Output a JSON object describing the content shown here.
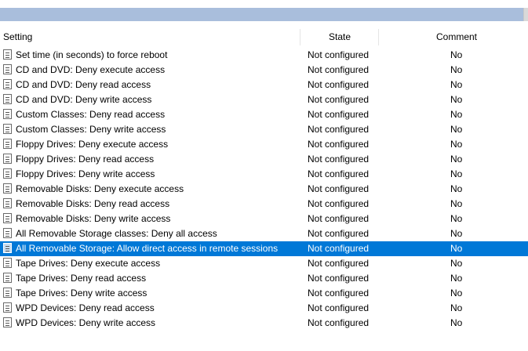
{
  "columns": {
    "setting": "Setting",
    "state": "State",
    "comment": "Comment"
  },
  "rows": [
    {
      "setting": "Set time (in seconds) to force reboot",
      "state": "Not configured",
      "comment": "No"
    },
    {
      "setting": "CD and DVD: Deny execute access",
      "state": "Not configured",
      "comment": "No"
    },
    {
      "setting": "CD and DVD: Deny read access",
      "state": "Not configured",
      "comment": "No"
    },
    {
      "setting": "CD and DVD: Deny write access",
      "state": "Not configured",
      "comment": "No"
    },
    {
      "setting": "Custom Classes: Deny read access",
      "state": "Not configured",
      "comment": "No"
    },
    {
      "setting": "Custom Classes: Deny write access",
      "state": "Not configured",
      "comment": "No"
    },
    {
      "setting": "Floppy Drives: Deny execute access",
      "state": "Not configured",
      "comment": "No"
    },
    {
      "setting": "Floppy Drives: Deny read access",
      "state": "Not configured",
      "comment": "No"
    },
    {
      "setting": "Floppy Drives: Deny write access",
      "state": "Not configured",
      "comment": "No"
    },
    {
      "setting": "Removable Disks: Deny execute access",
      "state": "Not configured",
      "comment": "No"
    },
    {
      "setting": "Removable Disks: Deny read access",
      "state": "Not configured",
      "comment": "No"
    },
    {
      "setting": "Removable Disks: Deny write access",
      "state": "Not configured",
      "comment": "No"
    },
    {
      "setting": "All Removable Storage classes: Deny all access",
      "state": "Not configured",
      "comment": "No"
    },
    {
      "setting": "All Removable Storage: Allow direct access in remote sessions",
      "state": "Not configured",
      "comment": "No",
      "selected": true
    },
    {
      "setting": "Tape Drives: Deny execute access",
      "state": "Not configured",
      "comment": "No"
    },
    {
      "setting": "Tape Drives: Deny read access",
      "state": "Not configured",
      "comment": "No"
    },
    {
      "setting": "Tape Drives: Deny write access",
      "state": "Not configured",
      "comment": "No"
    },
    {
      "setting": "WPD Devices: Deny read access",
      "state": "Not configured",
      "comment": "No"
    },
    {
      "setting": "WPD Devices: Deny write access",
      "state": "Not configured",
      "comment": "No"
    }
  ],
  "colors": {
    "selection": "#0078d7",
    "top_bar": "#a9bedc"
  },
  "icons": {
    "policy_setting": "policy-setting-icon"
  }
}
